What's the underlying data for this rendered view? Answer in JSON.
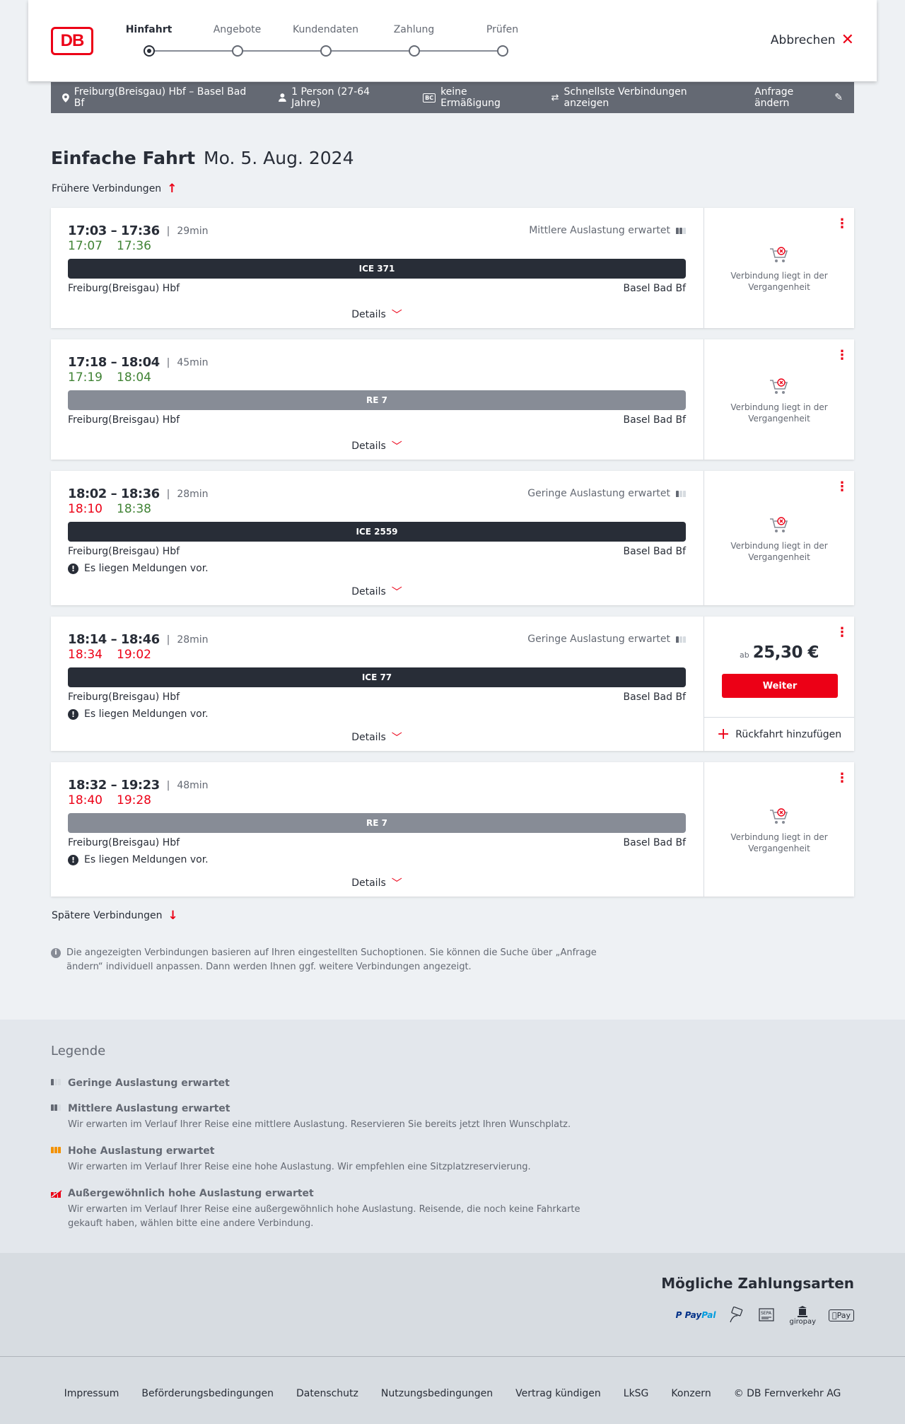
{
  "header": {
    "logo": "DB",
    "steps": [
      "Hinfahrt",
      "Angebote",
      "Kundendaten",
      "Zahlung",
      "Prüfen"
    ],
    "active_step": 0,
    "cancel": "Abbrechen"
  },
  "summary": {
    "route": "Freiburg(Breisgau) Hbf – Basel Bad Bf",
    "persons": "1 Person (27-64 Jahre)",
    "bc_badge": "BC",
    "discount": "keine Ermäßigung",
    "fastest": "Schnellste Verbindungen anzeigen",
    "change": "Anfrage ändern"
  },
  "page": {
    "title": "Einfache Fahrt",
    "date": "Mo. 5. Aug. 2024",
    "earlier": "Frühere Verbindungen",
    "later": "Spätere Verbindungen"
  },
  "connections": [
    {
      "planned": "17:03 – 17:36",
      "duration": "29min",
      "rt_dep": "17:07",
      "rt_arr": "17:36",
      "dep_delayed": false,
      "arr_delayed": false,
      "occupancy": "Mittlere Auslastung erwartet",
      "occupancy_level": 2,
      "train": "ICE 371",
      "train_type": "ice",
      "from": "Freiburg(Breisgau) Hbf",
      "to": "Basel Bad Bf",
      "message": "",
      "details": "Details",
      "status": "Verbindung liegt in der Vergangenheit"
    },
    {
      "planned": "17:18 – 18:04",
      "duration": "45min",
      "rt_dep": "17:19",
      "rt_arr": "18:04",
      "dep_delayed": false,
      "arr_delayed": false,
      "occupancy": "",
      "occupancy_level": 0,
      "train": "RE 7",
      "train_type": "re",
      "from": "Freiburg(Breisgau) Hbf",
      "to": "Basel Bad Bf",
      "message": "",
      "details": "Details",
      "status": "Verbindung liegt in der Vergangenheit"
    },
    {
      "planned": "18:02 – 18:36",
      "duration": "28min",
      "rt_dep": "18:10",
      "rt_arr": "18:38",
      "dep_delayed": true,
      "arr_delayed": false,
      "occupancy": "Geringe Auslastung erwartet",
      "occupancy_level": 1,
      "train": "ICE 2559",
      "train_type": "ice",
      "from": "Freiburg(Breisgau) Hbf",
      "to": "Basel Bad Bf",
      "message": "Es liegen Meldungen vor.",
      "details": "Details",
      "status": "Verbindung liegt in der Vergangenheit"
    },
    {
      "planned": "18:14 – 18:46",
      "duration": "28min",
      "rt_dep": "18:34",
      "rt_arr": "19:02",
      "dep_delayed": true,
      "arr_delayed": true,
      "occupancy": "Geringe Auslastung erwartet",
      "occupancy_level": 1,
      "train": "ICE 77",
      "train_type": "ice",
      "from": "Freiburg(Breisgau) Hbf",
      "to": "Basel Bad Bf",
      "message": "Es liegen Meldungen vor.",
      "details": "Details",
      "price_prefix": "ab",
      "price": "25,30 €",
      "button": "Weiter",
      "return": "Rückfahrt hinzufügen"
    },
    {
      "planned": "18:32 – 19:23",
      "duration": "48min",
      "rt_dep": "18:40",
      "rt_arr": "19:28",
      "dep_delayed": true,
      "arr_delayed": true,
      "occupancy": "",
      "occupancy_level": 0,
      "train": "RE 7",
      "train_type": "re",
      "from": "Freiburg(Breisgau) Hbf",
      "to": "Basel Bad Bf",
      "message": "Es liegen Meldungen vor.",
      "details": "Details",
      "status": "Verbindung liegt in der Vergangenheit"
    }
  ],
  "info": "Die angezeigten Verbindungen basieren auf Ihren eingestellten Suchoptionen. Sie können die Suche über „Anfrage ändern“ individuell anpassen. Dann werden Ihnen ggf. weitere Verbindungen angezeigt.",
  "legend": {
    "title": "Legende",
    "items": [
      {
        "title": "Geringe Auslastung erwartet",
        "desc": ""
      },
      {
        "title": "Mittlere Auslastung erwartet",
        "desc": "Wir erwarten im Verlauf Ihrer Reise eine mittlere Auslastung. Reservieren Sie bereits jetzt Ihren Wunschplatz."
      },
      {
        "title": "Hohe Auslastung erwartet",
        "desc": "Wir erwarten im Verlauf Ihrer Reise eine hohe Auslastung. Wir empfehlen eine Sitzplatzreservierung."
      },
      {
        "title": "Außergewöhnlich hohe Auslastung erwartet",
        "desc": "Wir erwarten im Verlauf Ihrer Reise eine außergewöhnlich hohe Auslastung. Reisende, die noch keine Fahrkarte gekauft haben, wählen bitte eine andere Verbindung."
      }
    ]
  },
  "payment": {
    "title": "Mögliche Zahlungsarten",
    "paypal_a": "Pay",
    "paypal_b": "Pal",
    "giropay": "giropay",
    "sepa": "SEPA",
    "applepay": "Pay"
  },
  "footer": [
    "Impressum",
    "Beförderungsbedingungen",
    "Datenschutz",
    "Nutzungsbedingungen",
    "Vertrag kündigen",
    "LkSG",
    "Konzern",
    "© DB Fernverkehr AG"
  ],
  "colors": {
    "brand": "#ec0016",
    "ontime": "#408335",
    "dark": "#282d37",
    "grey": "#646973"
  }
}
